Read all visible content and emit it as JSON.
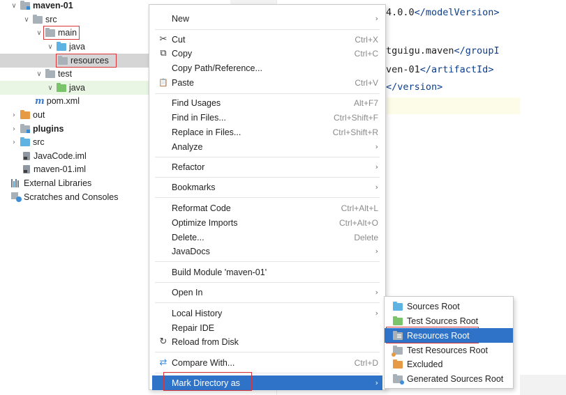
{
  "tree": {
    "items": [
      {
        "label": "maven-01",
        "arrow": "∨",
        "icon": "module-folder-icon"
      },
      {
        "label": "src",
        "arrow": "∨",
        "icon": "folder-icon"
      },
      {
        "label": "main",
        "arrow": "∨",
        "icon": "folder-icon"
      },
      {
        "label": "java",
        "arrow": "∨",
        "icon": "source-folder-icon"
      },
      {
        "label": "resources",
        "arrow": "",
        "icon": "resources-folder-icon"
      },
      {
        "label": "test",
        "arrow": "∨",
        "icon": "folder-icon"
      },
      {
        "label": "java",
        "arrow": "∨",
        "icon": "test-source-folder-icon"
      },
      {
        "label": "pom.xml",
        "icon_text": "m",
        "icon": "maven-file-icon"
      },
      {
        "label": "out",
        "arrow": "›",
        "icon": "excluded-folder-icon"
      },
      {
        "label": "plugins",
        "arrow": "›",
        "icon": "module-folder-icon"
      },
      {
        "label": "src",
        "arrow": "›",
        "icon": "source-folder-icon"
      },
      {
        "label": "JavaCode.iml",
        "icon": "iml-file-icon"
      },
      {
        "label": "maven-01.iml",
        "icon": "iml-file-icon"
      },
      {
        "label": "External Libraries",
        "icon": "libraries-icon"
      },
      {
        "label": "Scratches and Consoles",
        "icon": "scratches-icon"
      }
    ]
  },
  "editor": {
    "lines": [
      {
        "plain": "4.0.0",
        "tag": "</modelVersion>"
      },
      {
        "plain": "tguigu.maven",
        "tag": "</groupI"
      },
      {
        "plain": "ven-01",
        "tag": "</artifactId>"
      },
      {
        "plain": "",
        "tag": "</version>"
      }
    ]
  },
  "context_menu": {
    "items": [
      {
        "label": "New",
        "submenu": "›"
      },
      {
        "icon": "✂",
        "icon_name": "cut-icon",
        "label": "Cut",
        "shortcut": "Ctrl+X"
      },
      {
        "icon": "⧉",
        "icon_name": "copy-icon",
        "label": "Copy",
        "shortcut": "Ctrl+C"
      },
      {
        "label": "Copy Path/Reference..."
      },
      {
        "icon": "📋",
        "icon_name": "paste-icon",
        "label": "Paste",
        "shortcut": "Ctrl+V"
      },
      {
        "label": "Find Usages",
        "shortcut": "Alt+F7"
      },
      {
        "label": "Find in Files...",
        "shortcut": "Ctrl+Shift+F"
      },
      {
        "label": "Replace in Files...",
        "shortcut": "Ctrl+Shift+R"
      },
      {
        "label": "Analyze",
        "submenu": "›"
      },
      {
        "label": "Refactor",
        "submenu": "›"
      },
      {
        "label": "Bookmarks",
        "submenu": "›"
      },
      {
        "label": "Reformat Code",
        "shortcut": "Ctrl+Alt+L"
      },
      {
        "label": "Optimize Imports",
        "shortcut": "Ctrl+Alt+O"
      },
      {
        "label": "Delete...",
        "shortcut": "Delete"
      },
      {
        "label": "JavaDocs",
        "submenu": "›"
      },
      {
        "label": "Build Module 'maven-01'"
      },
      {
        "label": "Open In",
        "submenu": "›"
      },
      {
        "label": "Local History",
        "submenu": "›"
      },
      {
        "label": "Repair IDE"
      },
      {
        "icon": "↻",
        "icon_name": "reload-icon",
        "label": "Reload from Disk"
      },
      {
        "icon": "⇄",
        "icon_name": "compare-icon",
        "label": "Compare With...",
        "shortcut": "Ctrl+D"
      },
      {
        "label": "Mark Directory as",
        "submenu": "›"
      }
    ]
  },
  "submenu": {
    "items": [
      {
        "label": "Sources Root",
        "icon": "sources-root-icon"
      },
      {
        "label": "Test Sources Root",
        "icon": "test-sources-root-icon"
      },
      {
        "label": "Resources Root",
        "icon": "resources-root-icon"
      },
      {
        "label": "Test Resources Root",
        "icon": "test-resources-root-icon"
      },
      {
        "label": "Excluded",
        "icon": "excluded-icon"
      },
      {
        "label": "Generated Sources Root",
        "icon": "generated-sources-root-icon"
      }
    ]
  },
  "colors": {
    "selection": "#2f73c9",
    "highlight_box": "#d9343a",
    "xml_tag": "#0b3d8c"
  }
}
